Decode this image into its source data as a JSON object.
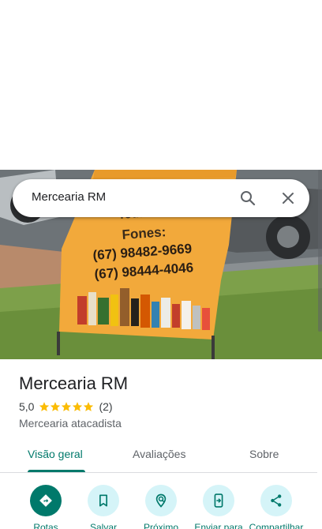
{
  "search": {
    "query": "Mercearia RM"
  },
  "hero_sign": {
    "line1": "Todas em Geral",
    "line2": "Fones:",
    "line3": "(67) 98482-9669",
    "line4": "(67) 98444-4046"
  },
  "place": {
    "name": "Mercearia RM",
    "rating": "5,0",
    "stars": 5,
    "review_count": "(2)",
    "category": "Mercearia atacadista"
  },
  "tabs": [
    {
      "label": "Visão geral",
      "active": true
    },
    {
      "label": "Avaliações",
      "active": false
    },
    {
      "label": "Sobre",
      "active": false
    }
  ],
  "actions": [
    {
      "label": "Rotas",
      "icon": "directions-icon"
    },
    {
      "label": "Salvar",
      "icon": "bookmark-icon"
    },
    {
      "label": "Próximo",
      "icon": "nearby-icon"
    },
    {
      "label": "Enviar para",
      "icon": "send-to-phone-icon"
    },
    {
      "label": "Compartilhar",
      "icon": "share-icon"
    }
  ],
  "colors": {
    "accent": "#00796b",
    "action_bg": "#d5f4f8",
    "star": "#fbbc04"
  }
}
